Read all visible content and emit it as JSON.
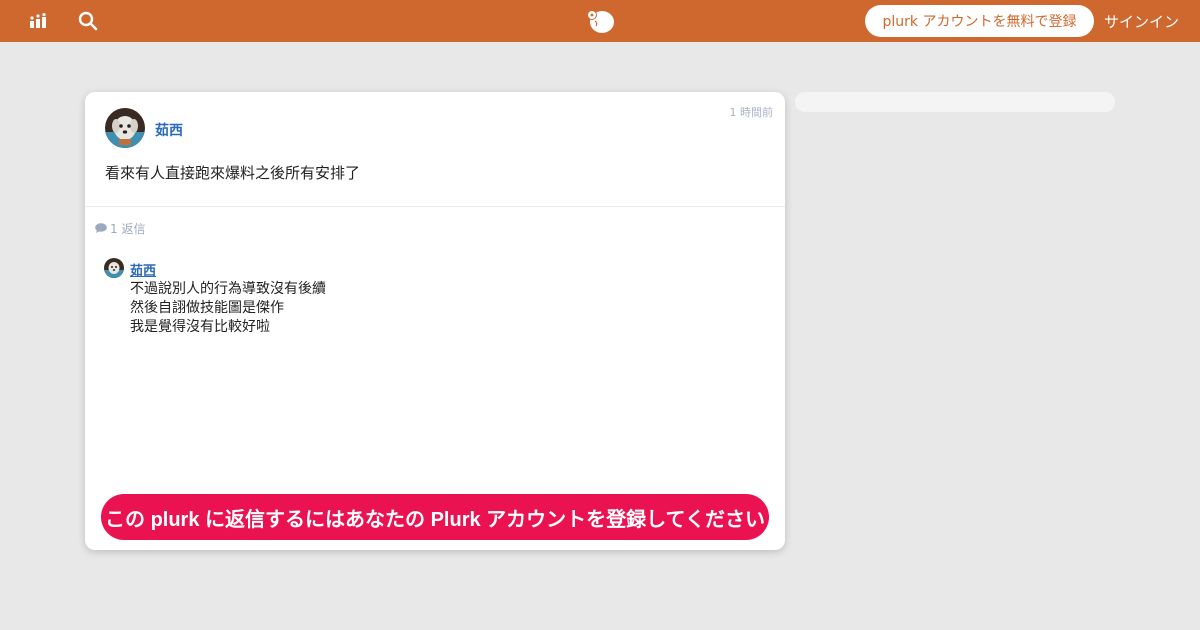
{
  "header": {
    "signup_label": "plurk アカウントを無料で登録",
    "signin_label": "サインイン",
    "icons": [
      "timeline-icon",
      "search-icon",
      "plurk-logo-icon"
    ],
    "bar_color": "#cf682f"
  },
  "post": {
    "author": "茹西",
    "time": "1 時間前",
    "content": "看來有人直接跑來爆料之後所有安排了",
    "reply_count_label": "1 返信"
  },
  "replies": [
    {
      "author": "茹西",
      "lines": [
        "不過說別人的行為導致沒有後續",
        "然後自詡做技能圖是傑作",
        "我是覺得沒有比較好啦"
      ]
    }
  ],
  "cta": {
    "register_label": "この plurk に返信するにはあなたの Plurk アカウントを登録してください",
    "color": "#ea1250"
  }
}
